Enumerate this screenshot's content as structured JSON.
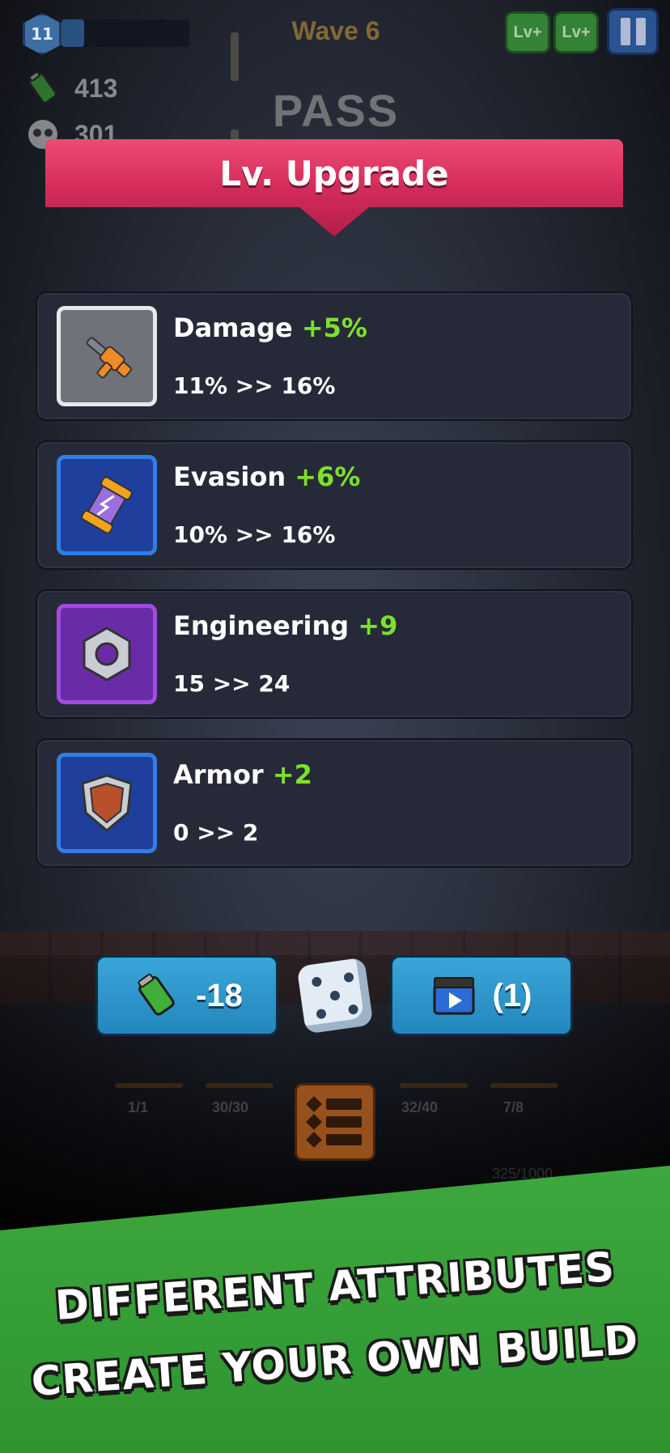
{
  "hud": {
    "player_level": "11",
    "wave": "Wave 6",
    "lv_plus_1": "Lv+",
    "lv_plus_2": "Lv+",
    "battery_count": "413",
    "kill_count": "301",
    "pass": "PASS"
  },
  "panel": {
    "title": "Lv. Upgrade",
    "options": [
      {
        "name": "Damage",
        "bonus": "+5%",
        "range": "11% >> 16%",
        "icon": "rifle-icon"
      },
      {
        "name": "Evasion",
        "bonus": "+6%",
        "range": "10% >> 16%",
        "icon": "energy-canister-icon"
      },
      {
        "name": "Engineering",
        "bonus": "+9",
        "range": "15 >> 24",
        "icon": "hex-nut-icon"
      },
      {
        "name": "Armor",
        "bonus": "+2",
        "range": "0 >> 2",
        "icon": "shield-icon"
      }
    ]
  },
  "actions": {
    "refresh_cost": "-18",
    "ad_count": "(1)",
    "slots": [
      "1/1",
      "30/30",
      "32/40",
      "7/8"
    ],
    "hidden_count": "325/1000"
  },
  "footer": {
    "line1": "DIFFERENT ATTRIBUTES",
    "line2": "CREATE YOUR OWN BUILD"
  },
  "colors": {
    "accent_bonus": "#7be22b",
    "banner": "#d42c5a",
    "button_blue": "#2286bd",
    "footer_green": "#3da83d"
  }
}
